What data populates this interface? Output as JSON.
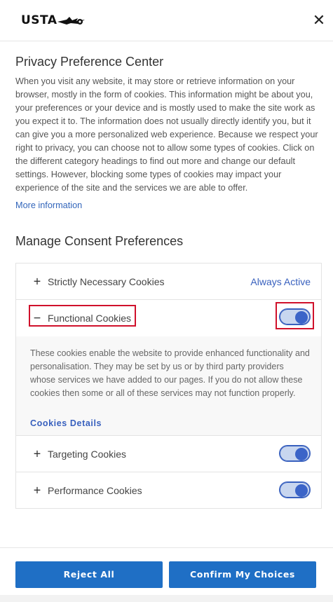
{
  "header": {
    "logo_text": "USTA",
    "close_icon": "close-icon"
  },
  "main": {
    "title": "Privacy Preference Center",
    "description": "When you visit any website, it may store or retrieve information on your browser, mostly in the form of cookies. This information might be about you, your preferences or your device and is mostly used to make the site work as you expect it to. The information does not usually directly identify you, but it can give you a more personalized web experience. Because we respect your right to privacy, you can choose not to allow some types of cookies. Click on the different category headings to find out more and change our default settings. However, blocking some types of cookies may impact your experience of the site and the services we are able to offer.",
    "more_info": "More information",
    "manage_title": "Manage Consent Preferences"
  },
  "categories": {
    "strict": {
      "label": "Strictly Necessary Cookies",
      "status": "Always Active",
      "icon": "+"
    },
    "functional": {
      "label": "Functional Cookies",
      "icon": "−",
      "enabled": true,
      "description": "These cookies enable the website to provide enhanced functionality and personalisation. They may be set by us or by third party providers whose services we have added to our pages. If you do not allow these cookies then some or all of these services may not function properly.",
      "details_link": "Cookies Details"
    },
    "targeting": {
      "label": "Targeting Cookies",
      "icon": "+",
      "enabled": true
    },
    "performance": {
      "label": "Performance Cookies",
      "icon": "+",
      "enabled": true
    }
  },
  "footer": {
    "reject_label": "Reject All",
    "confirm_label": "Confirm My Choices"
  },
  "colors": {
    "accent": "#3860be",
    "button": "#1f6fc5",
    "highlight": "#d0112b"
  }
}
